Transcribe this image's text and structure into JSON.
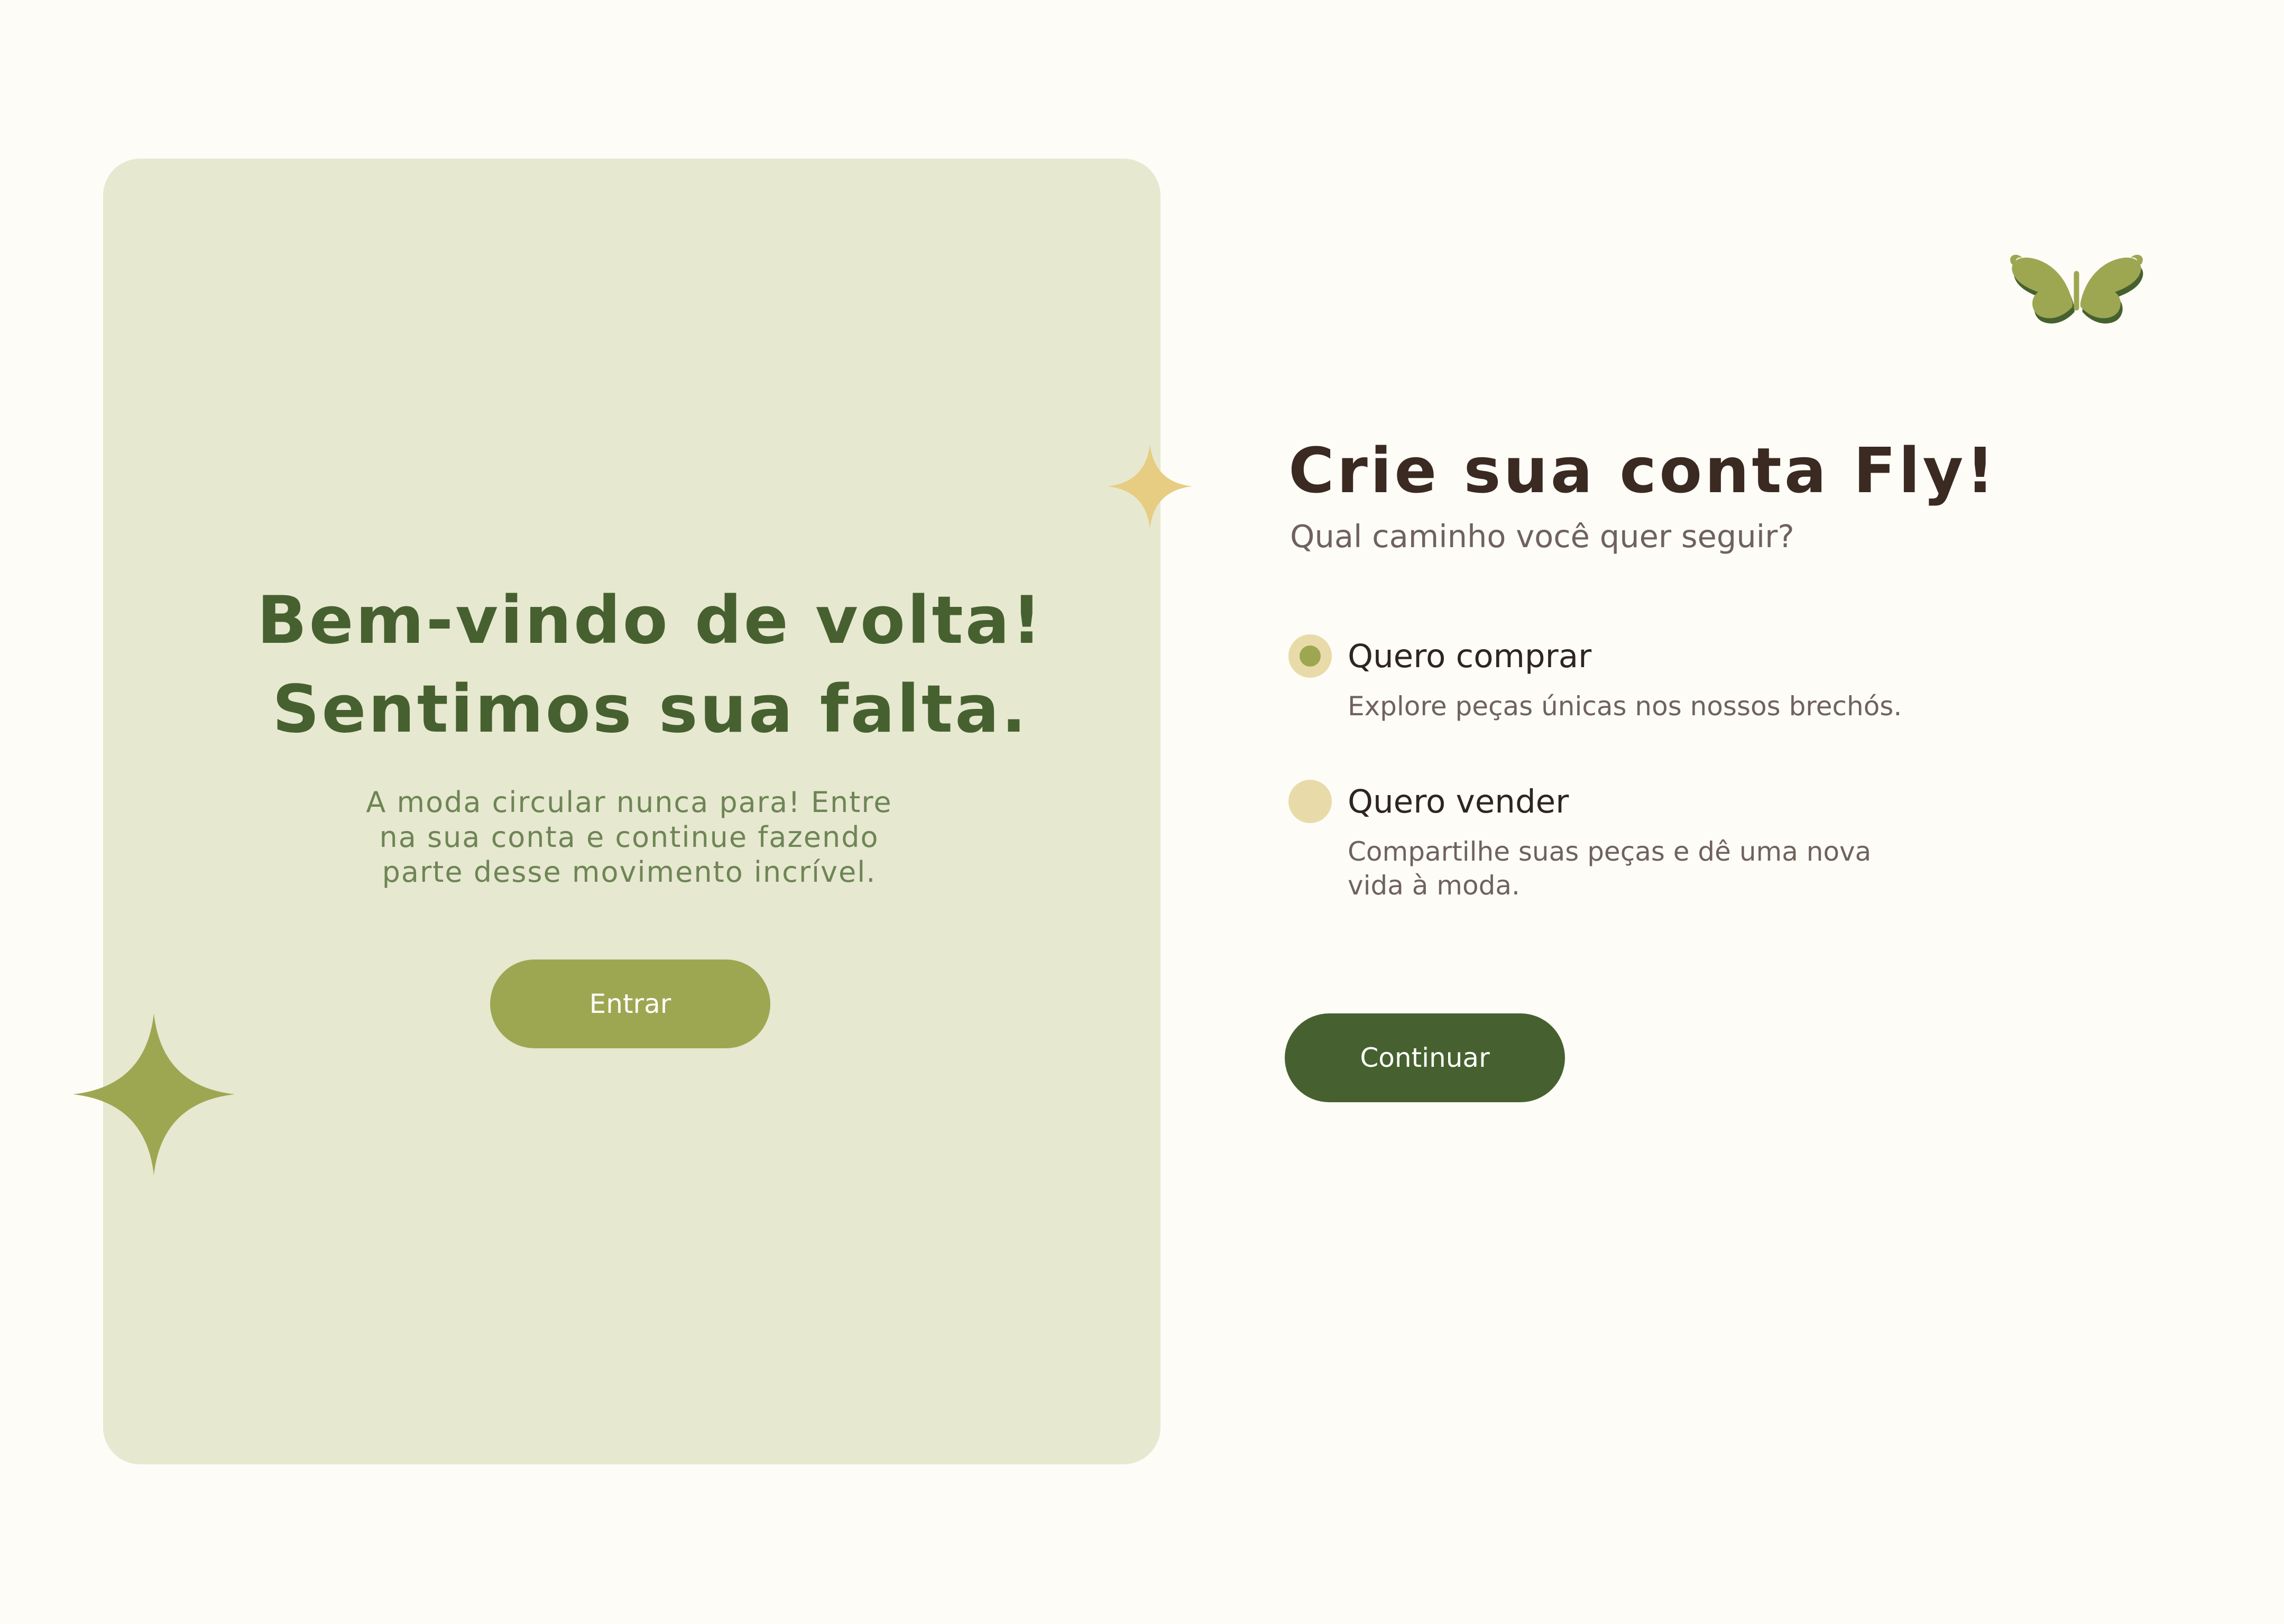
{
  "colors": {
    "background": "#FDFCF7",
    "card": "#E7E8D0",
    "dark_green": "#46612F",
    "olive": "#9DA752",
    "gold": "#E6CD82",
    "brown": "#3B2A22",
    "radio_ring": "#E8DBA9"
  },
  "welcome": {
    "title_line1": "Bem-vindo de volta!",
    "title_line2": "Sentimos sua falta.",
    "description_line1": "A moda circular nunca para! Entre",
    "description_line2": "na sua conta e continue fazendo",
    "description_line3": "parte desse movimento incrível.",
    "login_button": "Entrar"
  },
  "signup": {
    "title": "Crie sua conta Fly!",
    "subtitle": "Qual caminho você quer seguir?",
    "options": [
      {
        "label": "Quero comprar",
        "description": "Explore peças únicas nos nossos brechós.",
        "selected": true
      },
      {
        "label": "Quero vender",
        "description_line1": "Compartilhe suas peças e dê uma nova",
        "description_line2": "vida à moda.",
        "selected": false
      }
    ],
    "continue_button": "Continuar"
  },
  "icons": {
    "logo": "butterfly-logo-icon",
    "sparkle_gold": "sparkle-gold-icon",
    "sparkle_green": "sparkle-green-icon"
  }
}
